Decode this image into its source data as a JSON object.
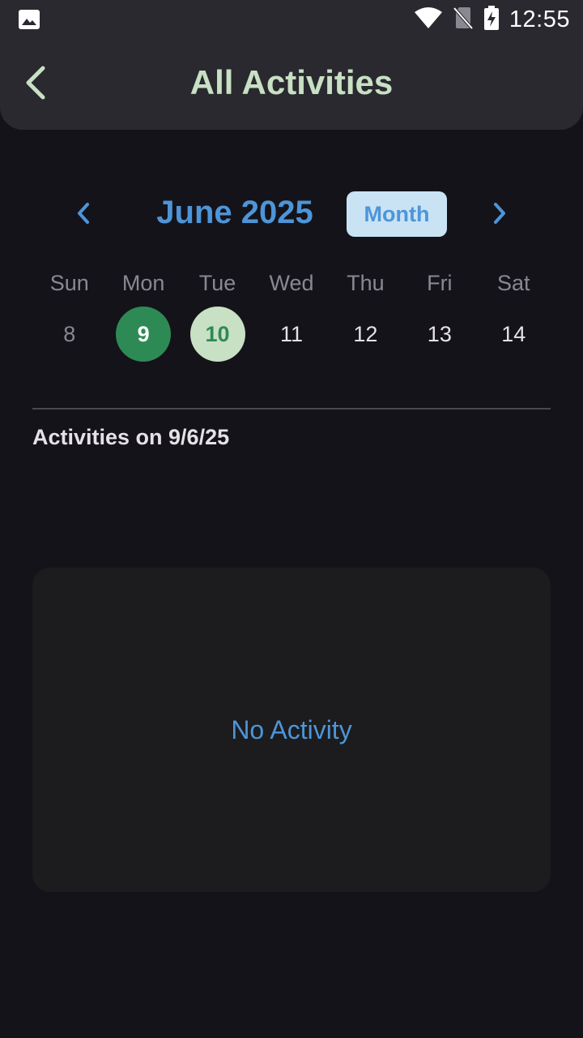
{
  "status_bar": {
    "time": "12:55",
    "icons": [
      "image-icon",
      "wifi-icon",
      "no-sim-icon",
      "battery-charging-icon"
    ]
  },
  "app_bar": {
    "title": "All Activities",
    "back_icon": "back-arrow-icon"
  },
  "calendar": {
    "month_label": "June 2025",
    "view_toggle_label": "Month",
    "weekdays": [
      "Sun",
      "Mon",
      "Tue",
      "Wed",
      "Thu",
      "Fri",
      "Sat"
    ],
    "dates": [
      "8",
      "9",
      "10",
      "11",
      "12",
      "13",
      "14"
    ],
    "selected_date": "9",
    "today_date": "10"
  },
  "activities": {
    "heading": "Activities on 9/6/25",
    "empty_message": "No Activity"
  },
  "colors": {
    "accent_blue": "#4d95d8",
    "selected_green": "#2e8a55",
    "title_green": "#c8e0c4",
    "background": "#15131a"
  }
}
